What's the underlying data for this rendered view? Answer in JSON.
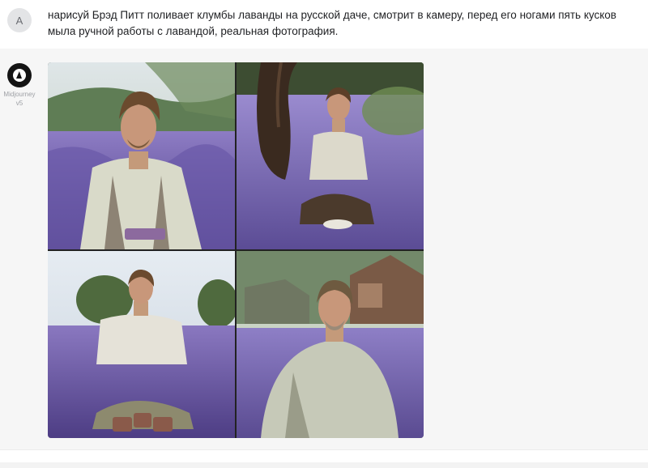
{
  "user_message": {
    "avatar_letter": "A",
    "prompt": "нарисуй Брэд Питт поливает клумбы лаванды на русской даче, смотрит в камеру, перед его ногами пять кусков мыла ручной работы с лавандой, реальная фотография."
  },
  "bot_message": {
    "name": "Midjourney",
    "version": "v5",
    "avatar_icon": "sailboat-icon",
    "images": [
      "generated-image-1",
      "generated-image-2",
      "generated-image-3",
      "generated-image-4"
    ]
  },
  "colors": {
    "user_row_bg": "#ffffff",
    "bot_row_bg": "#f6f6f6",
    "text": "#1f2023",
    "muted": "#9ea0a5",
    "lavender": "#7a68b8"
  }
}
